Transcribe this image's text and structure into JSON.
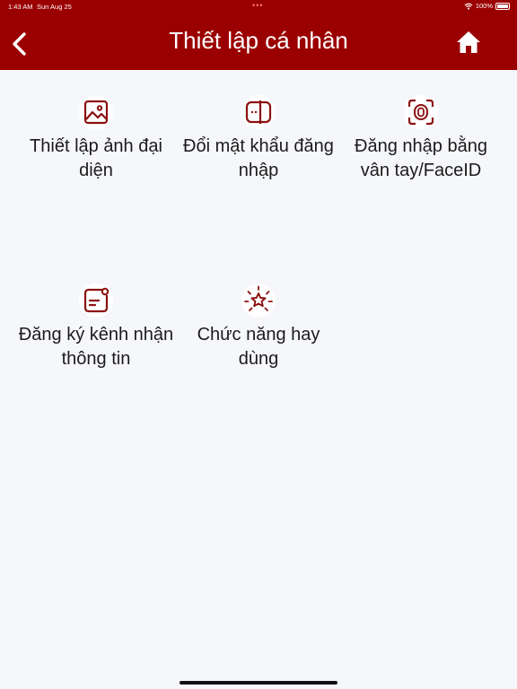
{
  "status_bar": {
    "time": "1:43 AM",
    "date": "Sun Aug 25",
    "battery": "100%"
  },
  "header": {
    "title": "Thiết lập cá nhân"
  },
  "icons": {
    "back": "chevron-left-icon",
    "home": "home-icon"
  },
  "colors": {
    "brand": "#9b0000",
    "icon": "#8c1010",
    "background": "#f6f7fb"
  },
  "menu": [
    {
      "label": "Thiết lập ảnh đại diện",
      "icon": "image-icon"
    },
    {
      "label": "Đổi mật khẩu đăng nhập",
      "icon": "password-icon"
    },
    {
      "label": "Đăng nhập bằng vân tay/FaceID",
      "icon": "fingerprint-icon"
    },
    {
      "label": "Đăng ký kênh nhận thông tin",
      "icon": "notification-icon"
    },
    {
      "label": "Chức năng hay dùng",
      "icon": "star-icon"
    }
  ]
}
